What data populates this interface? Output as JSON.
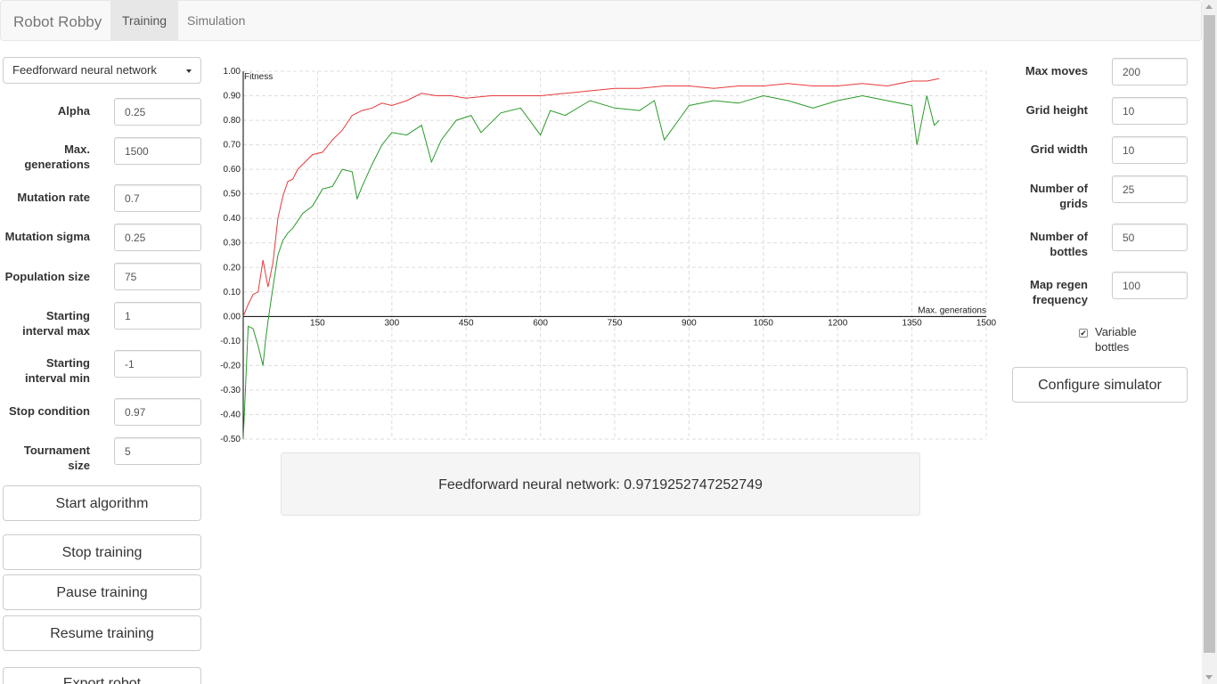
{
  "navbar": {
    "brand": "Robot Robby",
    "tabs": [
      {
        "label": "Training",
        "active": true
      },
      {
        "label": "Simulation",
        "active": false
      }
    ]
  },
  "left": {
    "algorithm_select": "Feedforward neural network",
    "params": [
      {
        "label": "Alpha",
        "value": "0.25"
      },
      {
        "label": "Max. generations",
        "value": "1500"
      },
      {
        "label": "Mutation rate",
        "value": "0.7"
      },
      {
        "label": "Mutation sigma",
        "value": "0.25"
      },
      {
        "label": "Population size",
        "value": "75"
      },
      {
        "label": "Starting interval max",
        "value": "1"
      },
      {
        "label": "Starting interval min",
        "value": "-1"
      },
      {
        "label": "Stop condition",
        "value": "0.97"
      },
      {
        "label": "Tournament size",
        "value": "5"
      }
    ],
    "buttons": {
      "start": "Start algorithm",
      "stop": "Stop training",
      "pause": "Pause training",
      "resume": "Resume training",
      "export": "Export robot"
    }
  },
  "right": {
    "params": [
      {
        "label": "Max moves",
        "value": "200"
      },
      {
        "label": "Grid height",
        "value": "10"
      },
      {
        "label": "Grid width",
        "value": "10"
      },
      {
        "label": "Number of grids",
        "value": "25"
      },
      {
        "label": "Number of bottles",
        "value": "50"
      },
      {
        "label": "Map regen frequency",
        "value": "100"
      }
    ],
    "variable_bottles": {
      "label": "Variable bottles",
      "checked": true,
      "check_glyph": "✔"
    },
    "configure_button": "Configure simulator"
  },
  "result_text": "Feedforward neural network: 0.9719252747252749",
  "chart_data": {
    "type": "line",
    "ylabel": "Fitness",
    "xlabel": "Max. generations",
    "xlim": [
      0,
      1500
    ],
    "ylim": [
      -0.5,
      1.0
    ],
    "x_ticks": [
      "150",
      "300",
      "450",
      "600",
      "750",
      "900",
      "1050",
      "1200",
      "1350",
      "1500"
    ],
    "y_ticks": [
      "1.00",
      "0.90",
      "0.80",
      "0.70",
      "0.60",
      "0.50",
      "0.40",
      "0.30",
      "0.20",
      "0.10",
      "0.00",
      "-0.10",
      "-0.20",
      "-0.30",
      "-0.40",
      "-0.50"
    ],
    "grid": true,
    "series": [
      {
        "color": "#e8393b",
        "x": [
          0,
          10,
          20,
          30,
          40,
          50,
          60,
          70,
          80,
          90,
          100,
          110,
          120,
          140,
          160,
          180,
          200,
          220,
          240,
          260,
          280,
          300,
          330,
          360,
          390,
          420,
          450,
          500,
          550,
          600,
          650,
          700,
          750,
          800,
          850,
          900,
          950,
          1000,
          1050,
          1100,
          1150,
          1200,
          1250,
          1300,
          1350,
          1380,
          1405
        ],
        "values": [
          0.0,
          0.05,
          0.09,
          0.1,
          0.23,
          0.12,
          0.22,
          0.4,
          0.49,
          0.55,
          0.56,
          0.6,
          0.62,
          0.66,
          0.67,
          0.72,
          0.76,
          0.82,
          0.84,
          0.85,
          0.87,
          0.86,
          0.88,
          0.91,
          0.9,
          0.9,
          0.89,
          0.9,
          0.9,
          0.9,
          0.91,
          0.92,
          0.93,
          0.93,
          0.94,
          0.94,
          0.93,
          0.94,
          0.94,
          0.95,
          0.94,
          0.94,
          0.95,
          0.94,
          0.96,
          0.96,
          0.97
        ]
      },
      {
        "color": "#2a9a2a",
        "x": [
          0,
          10,
          20,
          30,
          40,
          45,
          50,
          60,
          70,
          80,
          90,
          100,
          120,
          140,
          160,
          180,
          200,
          220,
          230,
          240,
          260,
          280,
          300,
          330,
          360,
          380,
          400,
          430,
          460,
          480,
          520,
          560,
          600,
          620,
          650,
          700,
          750,
          800,
          830,
          850,
          900,
          950,
          1000,
          1050,
          1100,
          1150,
          1200,
          1250,
          1300,
          1350,
          1360,
          1380,
          1395,
          1405
        ],
        "values": [
          -0.5,
          -0.04,
          -0.05,
          -0.12,
          -0.2,
          -0.1,
          -0.02,
          0.12,
          0.25,
          0.31,
          0.34,
          0.36,
          0.42,
          0.45,
          0.52,
          0.53,
          0.6,
          0.59,
          0.48,
          0.53,
          0.62,
          0.7,
          0.75,
          0.74,
          0.78,
          0.63,
          0.72,
          0.8,
          0.82,
          0.75,
          0.83,
          0.85,
          0.74,
          0.84,
          0.82,
          0.88,
          0.85,
          0.84,
          0.88,
          0.72,
          0.86,
          0.88,
          0.87,
          0.9,
          0.88,
          0.85,
          0.88,
          0.9,
          0.88,
          0.86,
          0.7,
          0.9,
          0.78,
          0.8
        ]
      }
    ]
  }
}
